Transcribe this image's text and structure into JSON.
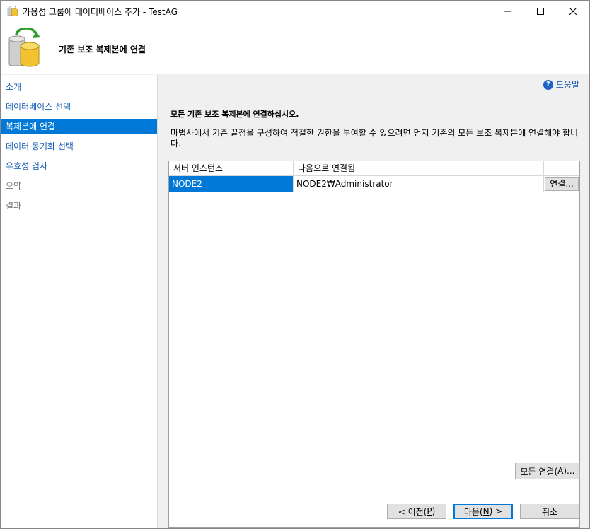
{
  "window": {
    "title": "가용성 그룹에 데이터베이스 추가 - TestAG",
    "icon": "database-wizard-icon"
  },
  "header": {
    "title": "기존 보조 복제본에 연결",
    "icon": "database-sync-icon"
  },
  "sidebar": {
    "items": [
      {
        "label": "소개",
        "state": "link"
      },
      {
        "label": "데이터베이스 선택",
        "state": "link"
      },
      {
        "label": "복제본에 연결",
        "state": "active"
      },
      {
        "label": "데이터 동기화 선택",
        "state": "link"
      },
      {
        "label": "유효성 검사",
        "state": "link"
      },
      {
        "label": "요약",
        "state": "disabled"
      },
      {
        "label": "결과",
        "state": "disabled"
      }
    ]
  },
  "help": {
    "label": "도움말",
    "icon": "help-icon"
  },
  "instructions": {
    "title": "모든 기존 보조 복제본에 연결하십시오.",
    "description": "마법사에서 기존 끝점을 구성하여 적절한 권한을 부여할 수 있으려면 먼저 기존의 모든 보조 복제본에 연결해야 합니다."
  },
  "grid": {
    "columns": [
      "서버 인스턴스",
      "다음으로 연결됨",
      ""
    ],
    "rows": [
      {
        "server": "NODE2",
        "connected_as": "NODE2₩Administrator",
        "button": "연결..."
      }
    ]
  },
  "buttons": {
    "connect_all_prefix": "모든 연결(",
    "connect_all_key": "A",
    "connect_all_suffix": ")...",
    "prev_prefix": "< 이전(",
    "prev_key": "P",
    "prev_suffix": ")",
    "next_prefix": "다음(",
    "next_key": "N",
    "next_suffix": ") >",
    "cancel": "취소"
  },
  "colors": {
    "accent": "#0078d7",
    "link": "#1a5fb4"
  }
}
